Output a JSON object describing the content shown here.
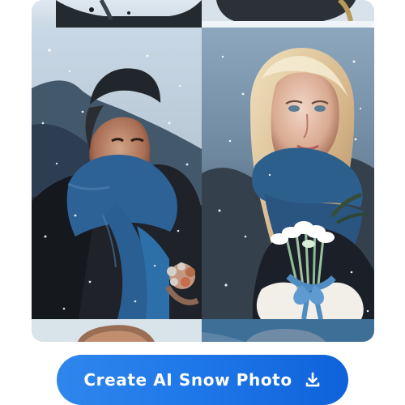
{
  "cta": {
    "label": "Create AI Snow Photo",
    "icon": "download-icon",
    "gradient_start": "#2f86ec",
    "gradient_end": "#0f62da",
    "text_color": "#ffffff"
  },
  "gallery": {
    "images": [
      {
        "name": "top-left-partial-photo"
      },
      {
        "name": "top-right-partial-photo"
      },
      {
        "name": "man-snow-portrait"
      },
      {
        "name": "woman-snow-portrait"
      },
      {
        "name": "bottom-left-partial-photo"
      },
      {
        "name": "bottom-right-partial-photo"
      }
    ]
  }
}
